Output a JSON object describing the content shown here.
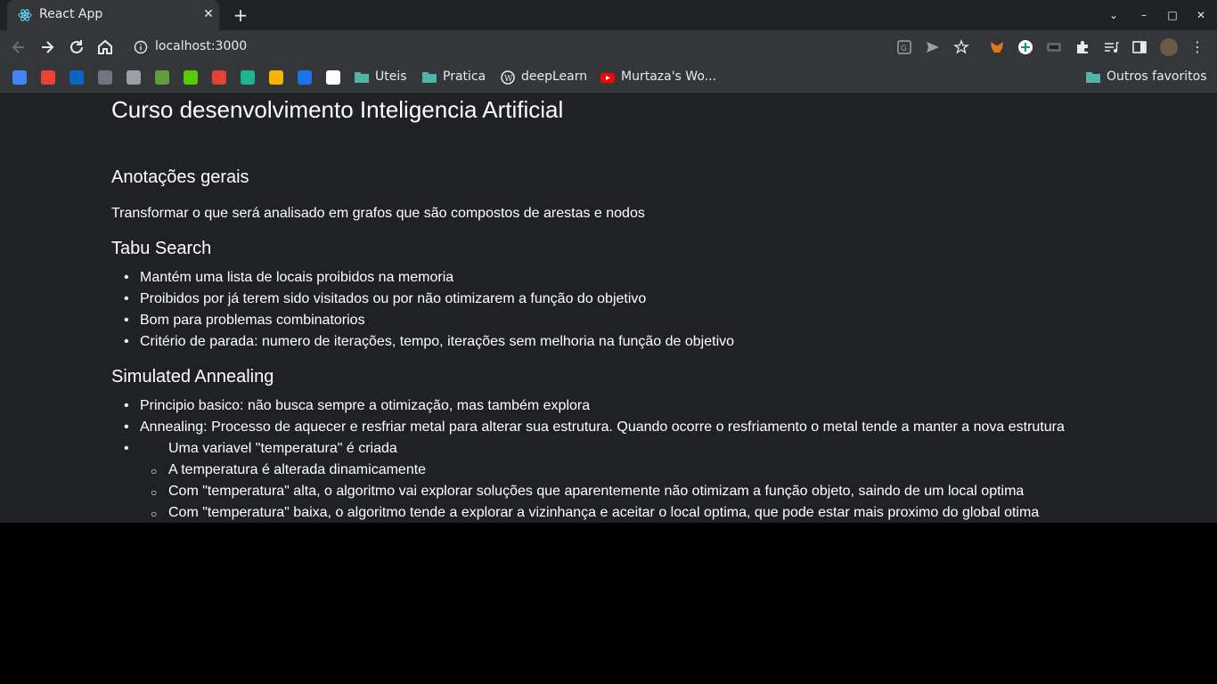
{
  "browser": {
    "tab_title": "React App",
    "url": "localhost:3000",
    "bookmarks": [
      {
        "label": "",
        "icon": "calendar-icon",
        "color": "#4285f4"
      },
      {
        "label": "",
        "icon": "gmail-icon",
        "color": "#ea4335"
      },
      {
        "label": "",
        "icon": "linkedin-icon",
        "color": "#0a66c2"
      },
      {
        "label": "",
        "icon": "github-icon",
        "color": "#6e7681"
      },
      {
        "label": "",
        "icon": "app-icon",
        "color": "#9aa0a6"
      },
      {
        "label": "",
        "icon": "figure-icon",
        "color": "#5f9e3f"
      },
      {
        "label": "",
        "icon": "duolingo-icon",
        "color": "#58cc02"
      },
      {
        "label": "",
        "icon": "todoist-icon",
        "color": "#e44332"
      },
      {
        "label": "",
        "icon": "app-green-icon",
        "color": "#1fb58f"
      },
      {
        "label": "",
        "icon": "app-colorful-icon",
        "color": "#f4b400"
      },
      {
        "label": "",
        "icon": "app-blue-icon",
        "color": "#1a73e8"
      },
      {
        "label": "",
        "icon": "eye-icon",
        "color": "#ffffff"
      },
      {
        "label": "Uteis",
        "icon": "folder-icon",
        "color": "#4fb3a8"
      },
      {
        "label": "Pratica",
        "icon": "folder-icon",
        "color": "#4fb3a8"
      },
      {
        "label": "deepLearn",
        "icon": "wordpress-icon",
        "color": "#e8eaed"
      },
      {
        "label": "Murtaza's Wo...",
        "icon": "youtube-icon",
        "color": "#ff0000"
      }
    ],
    "other_bookmarks": "Outros favoritos"
  },
  "page": {
    "title": "Curso desenvolvimento Inteligencia Artificial",
    "sections": [
      {
        "heading": "Anotações gerais",
        "paragraph": "Transformar o que será analisado em grafos que são compostos de arestas e nodos"
      },
      {
        "heading": "Tabu Search",
        "items": [
          "Mantém uma lista de locais proibidos na memoria",
          "Proibidos por já terem sido visitados ou por não otimizarem a função do objetivo",
          "Bom para problemas combinatorios",
          "Critério de parada: numero de iterações, tempo, iterações sem melhoria na função de objetivo"
        ]
      },
      {
        "heading": "Simulated Annealing",
        "items": [
          "Principio basico: não busca sempre a otimização, mas também explora",
          "Annealing: Processo de aquecer e resfriar metal para alterar sua estrutura. Quando ocorre o resfriamento o metal tende a manter a nova estrutura"
        ],
        "subitems": [
          "Uma variavel \"temperatura\" é criada",
          "A temperatura é alterada dinamicamente",
          "Com \"temperatura\" alta, o algoritmo vai explorar soluções que aparentemente não otimizam a função objeto, saindo de um local optima",
          "Com \"temperatura\" baixa, o algoritmo tende a explorar a vizinhança e aceitar o local optima, que pode estar mais proximo do global otima"
        ]
      }
    ]
  }
}
